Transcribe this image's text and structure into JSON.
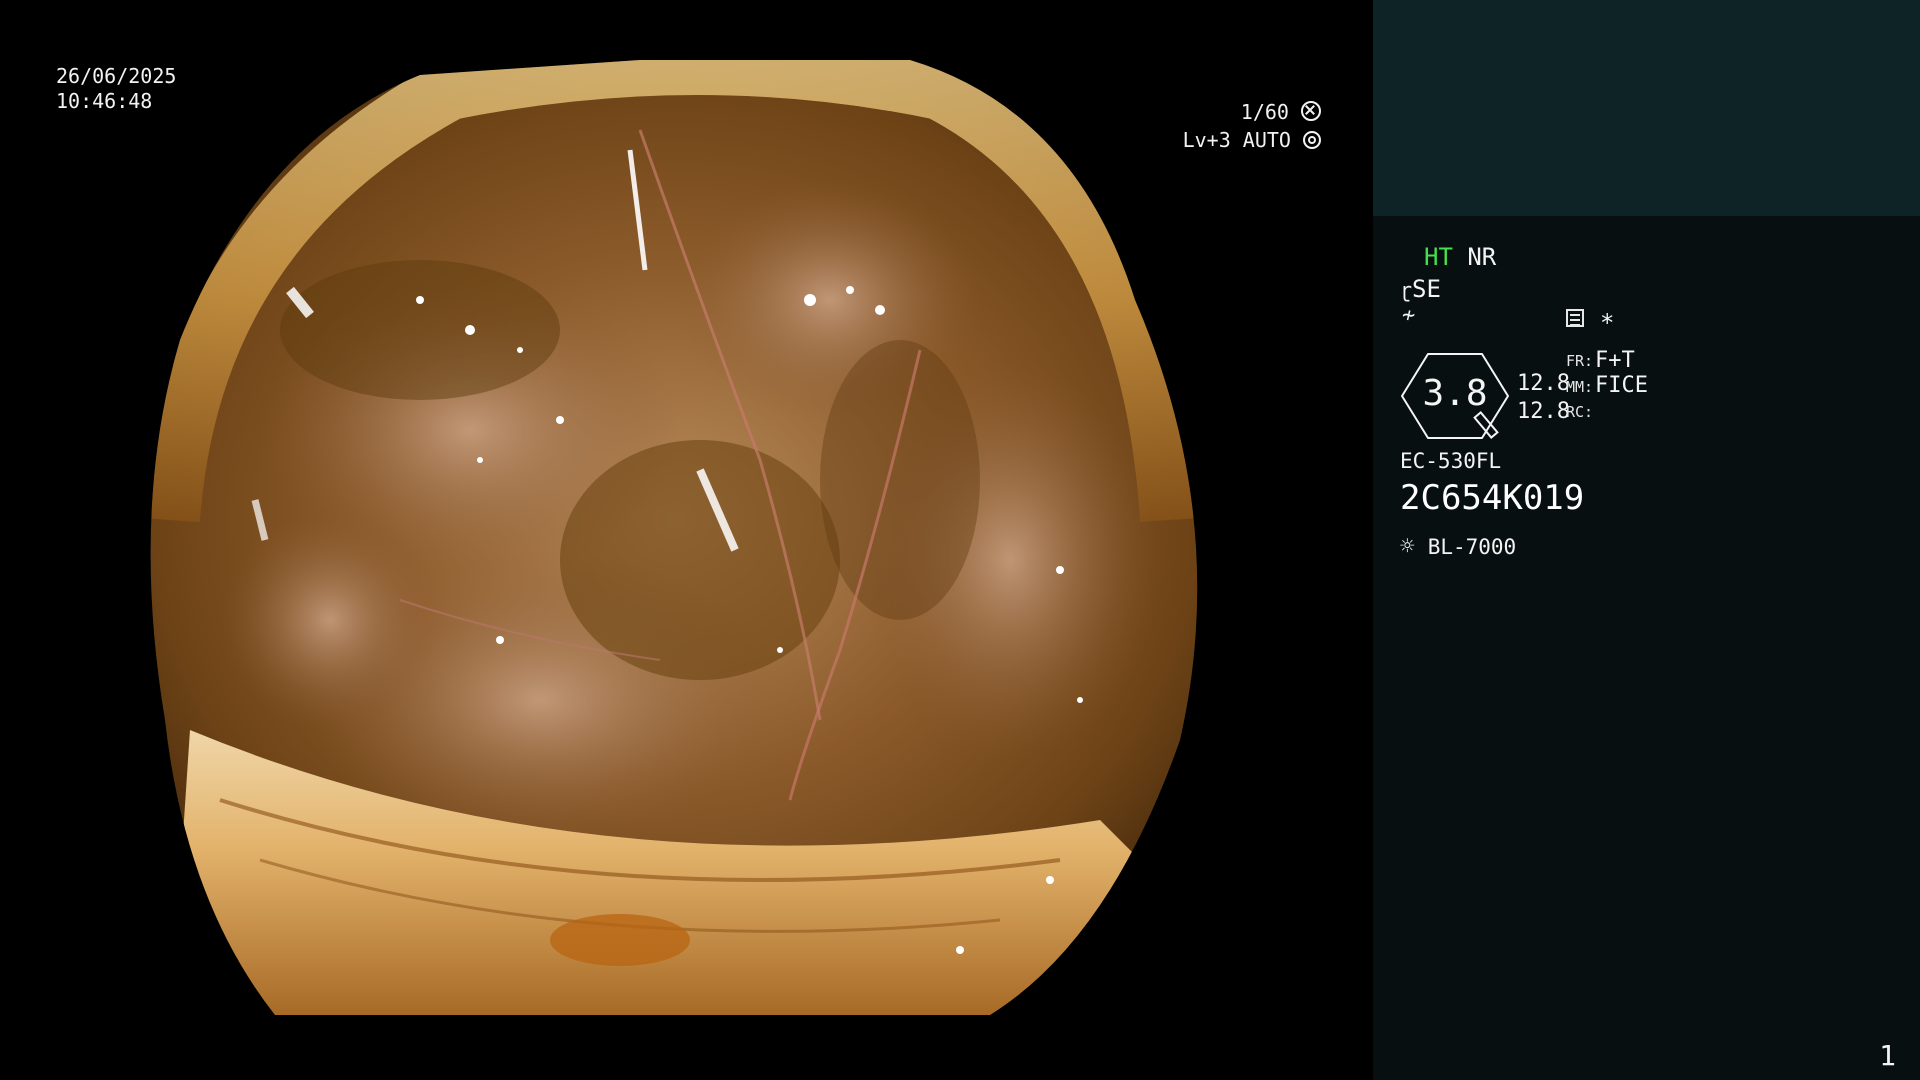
{
  "image": {
    "date": "26/06/2025",
    "time": "10:46:48",
    "shutter": "1/60",
    "shutter_icon": "aperture-icon",
    "exposure": "Lv+3 AUTO",
    "exposure_icon": "iris-icon"
  },
  "panel": {
    "ht": "HT",
    "nr": "NR",
    "se": "SE",
    "se_icon": "enhance-icon",
    "filter_icon": "color-filter-icon",
    "memo_icon": "memo-icon",
    "star": "*",
    "zoom": "3.8",
    "value1": "12.8",
    "value2": "12.8",
    "fr_label": "FR:",
    "fr_value": "F+T",
    "mm_label": "MM:",
    "mm_value": "FICE",
    "rc_label": "RC:",
    "scope_model": "EC-530FL",
    "serial": "2C654K019",
    "light_icon": "light-source-icon",
    "light_source": "BL-7000",
    "page_number": "1"
  },
  "colors": {
    "panel_bg": "#070f10",
    "thumb_bg": "#0d2325",
    "ht_green": "#44e14a"
  }
}
